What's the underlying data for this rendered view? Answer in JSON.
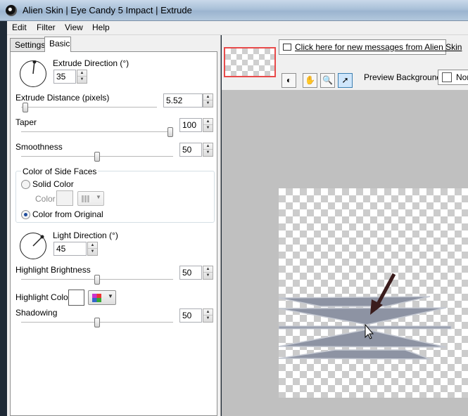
{
  "window": {
    "title": "Alien Skin | Eye Candy 5 Impact | Extrude"
  },
  "menu": {
    "items": [
      "Edit",
      "Filter",
      "View",
      "Help"
    ]
  },
  "tabs": [
    {
      "label": "Settings",
      "active": false
    },
    {
      "label": "Basic",
      "active": true
    }
  ],
  "controls": {
    "extrude_direction": {
      "label": "Extrude Direction (°)",
      "value": "35"
    },
    "extrude_distance": {
      "label": "Extrude Distance (pixels)",
      "value": "5.52",
      "level": 0.01
    },
    "taper": {
      "label": "Taper",
      "value": "100",
      "level": 1.0
    },
    "smoothness": {
      "label": "Smoothness",
      "value": "50",
      "level": 0.5
    },
    "side_faces": {
      "group_label": "Color of Side Faces",
      "solid_color": "Solid Color",
      "color_label": "Color",
      "color_from_original": "Color from Original",
      "selected": "Color from Original"
    },
    "light_direction": {
      "label": "Light Direction (°)",
      "value": "45"
    },
    "highlight_brightness": {
      "label": "Highlight Brightness",
      "value": "50",
      "level": 0.5
    },
    "highlight_color": {
      "label": "Highlight Color",
      "color": "#ffffff"
    },
    "shadowing": {
      "label": "Shadowing",
      "value": "50",
      "level": 0.5
    }
  },
  "preview": {
    "message_link": "Click here for new messages from Alien Skin",
    "background_label": "Preview Background:",
    "background_value": "Nom",
    "tools": [
      "preview-toggle-icon",
      "hand-icon",
      "zoom-icon",
      "pointer-icon"
    ]
  },
  "colors": {
    "thumbnail_border": "#e84a4a",
    "arrow": "#3a1c1c",
    "shape_fill": "#8d93a3"
  }
}
